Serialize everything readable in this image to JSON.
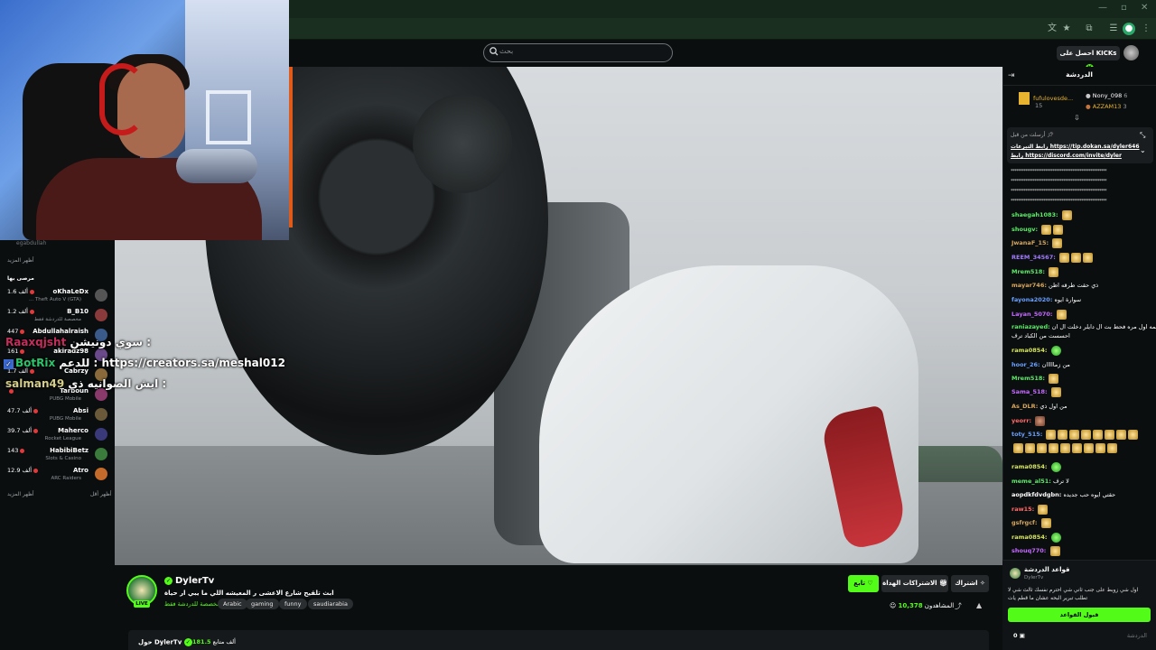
{
  "search": {
    "placeholder": "بحث"
  },
  "header": {
    "get_kicks": "احصل على KICKs"
  },
  "sidebar_left": {
    "top_user": "egabdullah",
    "show_more_top": "أظهر المزيد",
    "section_title": "مرصى بها",
    "channels": [
      {
        "name": "oKhaLeDx",
        "game": "... Theft Auto V (GTA)",
        "count": "1.6 ألف",
        "color": "#555"
      },
      {
        "name": "B_B10",
        "game": "مخصصة للدردشة فقط",
        "count": "1.2 ألف",
        "color": "#8a3a3a"
      },
      {
        "name": "Abdullahalraish",
        "game": "",
        "count": "447",
        "color": "#3a5a8a"
      },
      {
        "name": "akiradz98",
        "game": "",
        "count": "161",
        "color": "#6a4a8a"
      },
      {
        "name": "Cabrzy",
        "game": "",
        "count": "1.7 ألف",
        "color": "#8a6a3a"
      },
      {
        "name": "Tarboun",
        "game": "PUBG Mobile",
        "count": "",
        "color": "#8a3a6a"
      },
      {
        "name": "Absi",
        "game": "PUBG Mobile",
        "count": "47.7 ألف",
        "color": "#6a5a3a"
      },
      {
        "name": "Maherco",
        "game": "Rocket League",
        "count": "39.7 ألف",
        "color": "#3a3a7a"
      },
      {
        "name": "HabibiBetz",
        "game": "Slots & Casino",
        "count": "143",
        "color": "#3a7a3a"
      },
      {
        "name": "Atro",
        "game": "ARC Raiders",
        "count": "12.9 ألف",
        "color": "#c46a2a"
      }
    ],
    "show_more": "أظهر المزيد",
    "show_less": "أظهر أقل"
  },
  "overlay_chat": [
    {
      "user": "Raaxqjsht",
      "text": "سوي دونيشن :"
    },
    {
      "user": "BotRix",
      "text": "للدعم : https://creators.sa/meshal012"
    },
    {
      "user": "salman49",
      "text": "ايش الصوانيه ذي :"
    }
  ],
  "stream": {
    "name": "DylerTv",
    "live": "LIVE",
    "title": "ابث تلقيح شارع الاعشى ر المعيشه اللي ما يبي ار حياة",
    "category": "مخصصة للدردشة فقط",
    "tags": [
      "Arabic",
      "gaming",
      "funny",
      "saudiarabia"
    ],
    "follow": "تابع",
    "gift_subs": "الاشتراكات الهداة",
    "subscribe": "اشتراك",
    "viewers_label": "المشاهدون",
    "viewers": "10,378",
    "about": "حول DylerTv",
    "followers_label": "ألف متابع",
    "followers": "181.5"
  },
  "chat": {
    "title": "الدردشة",
    "leaders": [
      {
        "name": "fufulovesde...",
        "count": "15"
      },
      {
        "name": "Nony_098",
        "count": "6"
      },
      {
        "name": "AZZAM13",
        "count": "3"
      }
    ],
    "pinned": {
      "by": "أرسلت من قبل",
      "line1": "رابط التبرعات https://tip.dokan.sa/dyler646",
      "line2": "رابط https://discord.com/invite/dyler"
    },
    "stars": "*****************************************************",
    "messages": [
      {
        "user": "shaegah1083:",
        "color": "#5ee86a",
        "text": "",
        "emotes": [
          "gold"
        ]
      },
      {
        "user": "shougv:",
        "color": "#5ee86a",
        "text": "",
        "emotes": [
          "gold",
          "gold"
        ]
      },
      {
        "user": "JwanaF_15:",
        "color": "#d6a65e",
        "text": "",
        "emotes": [
          "gold"
        ]
      },
      {
        "user": "REEM_34567:",
        "color": "#a07bff",
        "text": "",
        "emotes": [
          "gold",
          "gold",
          "gold"
        ]
      },
      {
        "user": "Mrem518:",
        "color": "#5ee86a",
        "text": "",
        "emotes": [
          "gold"
        ]
      },
      {
        "user": "mayar746:",
        "color": "#d6a65e",
        "text": "ذي حقت طرقه اظن",
        "emotes": []
      },
      {
        "user": "fayona2020:",
        "color": "#6aa0ff",
        "text": "سوارة ايوه",
        "emotes": []
      },
      {
        "user": "Layan_5070:",
        "color": "#c46aff",
        "text": "",
        "emotes": [
          "gold"
        ]
      },
      {
        "user": "raniazayed:",
        "color": "#5ee86a",
        "text": "يمه اول مره فحط بت ال دايلر دخلت ال ان",
        "emotes": []
      },
      {
        "user": "",
        "color": "#fff",
        "text": "احسست من الكباد ترف",
        "emotes": []
      },
      {
        "user": "rama0854:",
        "color": "#d6e65e",
        "text": "",
        "emotes": [
          "green"
        ]
      },
      {
        "user": "hoor_26:",
        "color": "#6aa0ff",
        "text": "من زمااااان",
        "emotes": []
      },
      {
        "user": "Mrem518:",
        "color": "#5ee86a",
        "text": "",
        "emotes": [
          "gold"
        ]
      },
      {
        "user": "Sama_518:",
        "color": "#c46aff",
        "text": "",
        "emotes": [
          "gold"
        ]
      },
      {
        "user": "As_DLR:",
        "color": "#d6a65e",
        "text": "من اول ذي",
        "emotes": []
      },
      {
        "user": "yeorr:",
        "color": "#ff6a6a",
        "text": "",
        "emotes": [
          "face"
        ]
      },
      {
        "user": "toty_515:",
        "color": "#6aa0ff",
        "text": "",
        "emotes": [
          "gold",
          "gold",
          "gold",
          "gold",
          "gold",
          "gold",
          "gold",
          "gold"
        ]
      },
      {
        "user": "",
        "color": "#fff",
        "text": "",
        "emotes": [
          "gold",
          "gold",
          "gold",
          "gold",
          "gold",
          "gold",
          "gold",
          "gold",
          "gold"
        ]
      },
      {
        "user": "rama0854:",
        "color": "#d6e65e",
        "text": "",
        "emotes": [
          "green"
        ]
      },
      {
        "user": "meme_al51:",
        "color": "#5ee86a",
        "text": "لا ترف",
        "emotes": []
      },
      {
        "user": "aopdkfdvdgbn:",
        "color": "#fff",
        "text": "حقتي ايوه حب جديده",
        "emotes": []
      },
      {
        "user": "raw15:",
        "color": "#ff6a6a",
        "text": "",
        "emotes": [
          "gold"
        ]
      },
      {
        "user": "gsfrgcf:",
        "color": "#d6a65e",
        "text": "",
        "emotes": [
          "gold"
        ]
      },
      {
        "user": "rama0854:",
        "color": "#d6e65e",
        "text": "",
        "emotes": [
          "green"
        ]
      },
      {
        "user": "shouq770:",
        "color": "#c46aff",
        "text": "",
        "emotes": [
          "gold"
        ]
      }
    ],
    "rules_title": "قواعد الدردشة",
    "rules_sub": "DylerTv",
    "rules_body": "اول شي زوبط على جنب ثاني شي احترم نفسك ثالث شي لا تطلب تبرير البحه عشان ما قطم يات",
    "rules_button": "قبول القواعد",
    "input_placeholder": "الدردشة",
    "input_count": "0"
  }
}
